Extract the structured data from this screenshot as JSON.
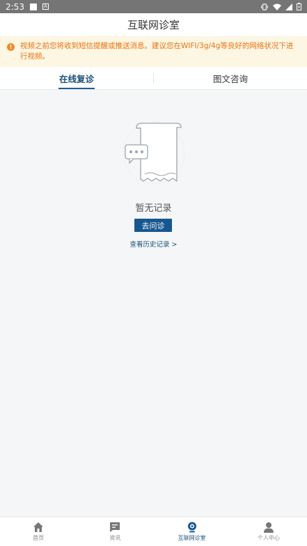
{
  "status_bar": {
    "time": "2:53",
    "letter_icon": "A"
  },
  "header": {
    "title": "互联网诊室"
  },
  "notice": {
    "icon": "!",
    "text": "视频之前您将收到短信提醒或推送消息。建议您在WIFI/3g/4g等良好的网络状况下进行视频。"
  },
  "tabs": [
    {
      "label": "在线复诊",
      "active": true
    },
    {
      "label": "图文咨询",
      "active": false
    }
  ],
  "empty_state": {
    "message": "暂无记录",
    "button_label": "去问诊",
    "history_link": "查看历史记录 >"
  },
  "bottom_nav": [
    {
      "label": "首页",
      "icon": "home-icon"
    },
    {
      "label": "资讯",
      "icon": "message-icon"
    },
    {
      "label": "互联网诊室",
      "icon": "webcam-icon",
      "active": true
    },
    {
      "label": "个人中心",
      "icon": "user-icon"
    }
  ],
  "colors": {
    "primary": "#17578f",
    "notice_text": "#e8730f",
    "notice_bg": "#fdf6e3",
    "status_bar": "#757575"
  }
}
